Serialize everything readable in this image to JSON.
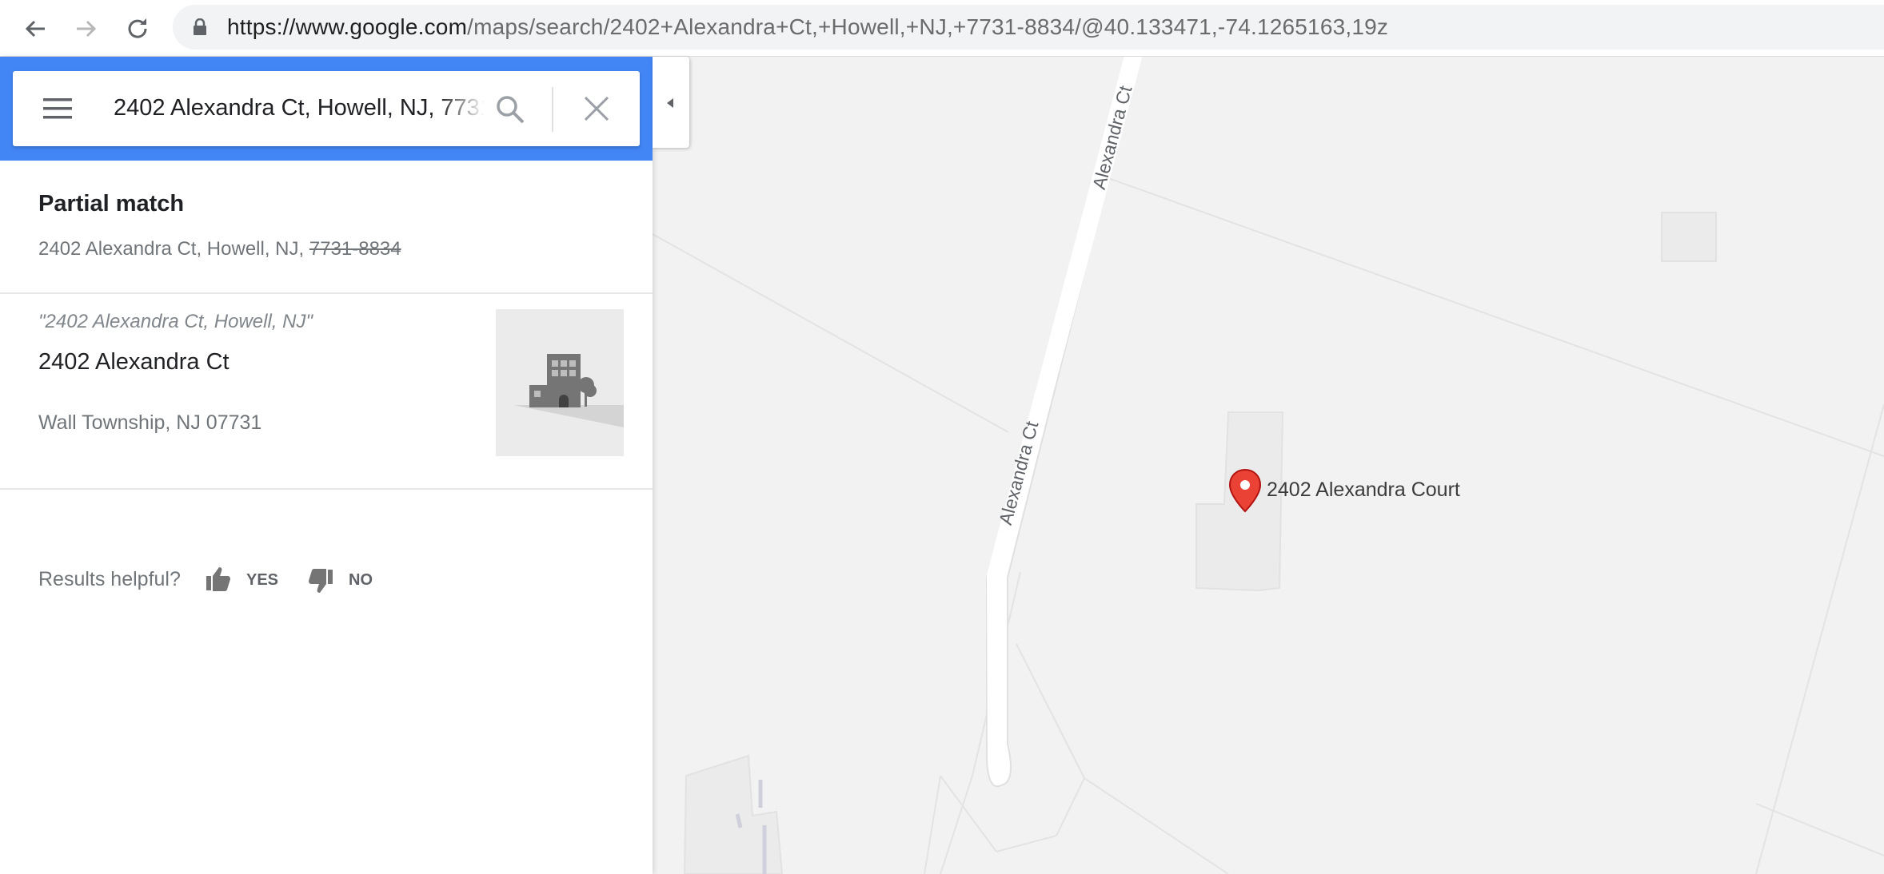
{
  "browser": {
    "url_host": "https://www.google.com",
    "url_path": "/maps/search/2402+Alexandra+Ct,+Howell,+NJ,+7731-8834/@40.133471,-74.1265163,19z"
  },
  "search": {
    "value": "2402 Alexandra Ct, Howell, NJ, 7731-8834"
  },
  "partial_match": {
    "title": "Partial match",
    "address_main": "2402 Alexandra Ct, Howell, NJ, ",
    "address_struck": "7731-8834"
  },
  "result": {
    "quote": "\"2402 Alexandra Ct, Howell, NJ\"",
    "name": "2402 Alexandra Ct",
    "locality": "Wall Township, NJ 07731"
  },
  "feedback": {
    "question": "Results helpful?",
    "yes": "YES",
    "no": "NO"
  },
  "map": {
    "road_label_top": "Alexandra Ct",
    "road_label_mid": "Alexandra Ct",
    "pin_label": "2402 Alexandra Court"
  },
  "colors": {
    "accent": "#4285f4",
    "pin": "#ea4335",
    "map_bg": "#f2f2f2",
    "road": "#ffffff"
  },
  "icons": [
    "back-icon",
    "forward-icon",
    "reload-icon",
    "lock-icon",
    "menu-icon",
    "search-icon",
    "close-icon",
    "collapse-icon",
    "thumb-up-icon",
    "thumb-down-icon",
    "map-pin-icon",
    "building-icon"
  ]
}
